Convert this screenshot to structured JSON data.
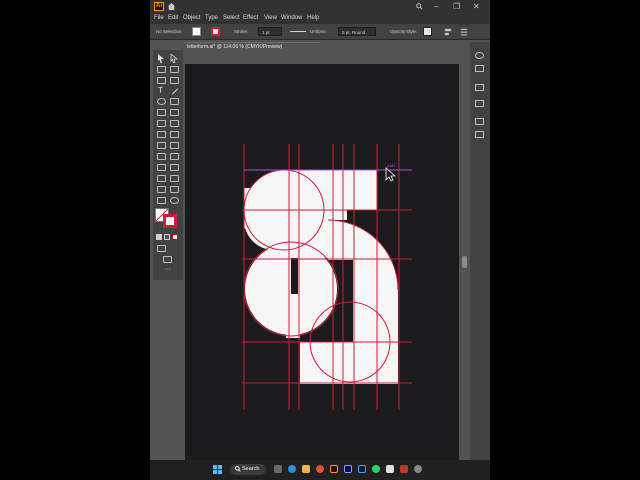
{
  "app": {
    "logo_text": "Ai"
  },
  "window": {
    "search_icon": "search-icon",
    "minimize": "–",
    "restore": "❐",
    "close": "✕"
  },
  "menu": {
    "items": [
      "File",
      "Edit",
      "Object",
      "Type",
      "Select",
      "Effect",
      "View",
      "Window",
      "Help"
    ]
  },
  "controlbar": {
    "selection": "No Selection",
    "stroke_label": "Stroke:",
    "stroke_weight": "1 pt",
    "stroke_profile": "Uniform",
    "brush": "5 pt. Round",
    "opacity_label": "Opacity",
    "style_label": "Style:"
  },
  "document": {
    "tab_title": "letterform.ai* @ 114.06 % (CMYK/Preview)",
    "smart_guide_label": "path",
    "colors": {
      "guide": "#d21a3a",
      "fill": "#f7f6f6",
      "artboard": "#1b1b1d",
      "smart_guide": "#b44de0"
    }
  },
  "taskbar": {
    "search_label": "Search"
  },
  "colors": {
    "app_bg": "#535353",
    "panel": "#424242",
    "menubar": "#323232",
    "accent": "#ff9a00"
  }
}
